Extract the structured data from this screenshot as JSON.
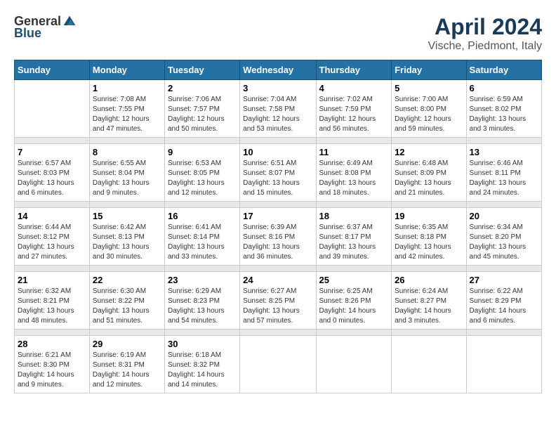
{
  "logo": {
    "general": "General",
    "blue": "Blue"
  },
  "title": "April 2024",
  "subtitle": "Vische, Piedmont, Italy",
  "days_header": [
    "Sunday",
    "Monday",
    "Tuesday",
    "Wednesday",
    "Thursday",
    "Friday",
    "Saturday"
  ],
  "weeks": [
    {
      "days": [
        {
          "number": "",
          "sunrise": "",
          "sunset": "",
          "daylight": ""
        },
        {
          "number": "1",
          "sunrise": "Sunrise: 7:08 AM",
          "sunset": "Sunset: 7:55 PM",
          "daylight": "Daylight: 12 hours and 47 minutes."
        },
        {
          "number": "2",
          "sunrise": "Sunrise: 7:06 AM",
          "sunset": "Sunset: 7:57 PM",
          "daylight": "Daylight: 12 hours and 50 minutes."
        },
        {
          "number": "3",
          "sunrise": "Sunrise: 7:04 AM",
          "sunset": "Sunset: 7:58 PM",
          "daylight": "Daylight: 12 hours and 53 minutes."
        },
        {
          "number": "4",
          "sunrise": "Sunrise: 7:02 AM",
          "sunset": "Sunset: 7:59 PM",
          "daylight": "Daylight: 12 hours and 56 minutes."
        },
        {
          "number": "5",
          "sunrise": "Sunrise: 7:00 AM",
          "sunset": "Sunset: 8:00 PM",
          "daylight": "Daylight: 12 hours and 59 minutes."
        },
        {
          "number": "6",
          "sunrise": "Sunrise: 6:59 AM",
          "sunset": "Sunset: 8:02 PM",
          "daylight": "Daylight: 13 hours and 3 minutes."
        }
      ]
    },
    {
      "days": [
        {
          "number": "7",
          "sunrise": "Sunrise: 6:57 AM",
          "sunset": "Sunset: 8:03 PM",
          "daylight": "Daylight: 13 hours and 6 minutes."
        },
        {
          "number": "8",
          "sunrise": "Sunrise: 6:55 AM",
          "sunset": "Sunset: 8:04 PM",
          "daylight": "Daylight: 13 hours and 9 minutes."
        },
        {
          "number": "9",
          "sunrise": "Sunrise: 6:53 AM",
          "sunset": "Sunset: 8:05 PM",
          "daylight": "Daylight: 13 hours and 12 minutes."
        },
        {
          "number": "10",
          "sunrise": "Sunrise: 6:51 AM",
          "sunset": "Sunset: 8:07 PM",
          "daylight": "Daylight: 13 hours and 15 minutes."
        },
        {
          "number": "11",
          "sunrise": "Sunrise: 6:49 AM",
          "sunset": "Sunset: 8:08 PM",
          "daylight": "Daylight: 13 hours and 18 minutes."
        },
        {
          "number": "12",
          "sunrise": "Sunrise: 6:48 AM",
          "sunset": "Sunset: 8:09 PM",
          "daylight": "Daylight: 13 hours and 21 minutes."
        },
        {
          "number": "13",
          "sunrise": "Sunrise: 6:46 AM",
          "sunset": "Sunset: 8:11 PM",
          "daylight": "Daylight: 13 hours and 24 minutes."
        }
      ]
    },
    {
      "days": [
        {
          "number": "14",
          "sunrise": "Sunrise: 6:44 AM",
          "sunset": "Sunset: 8:12 PM",
          "daylight": "Daylight: 13 hours and 27 minutes."
        },
        {
          "number": "15",
          "sunrise": "Sunrise: 6:42 AM",
          "sunset": "Sunset: 8:13 PM",
          "daylight": "Daylight: 13 hours and 30 minutes."
        },
        {
          "number": "16",
          "sunrise": "Sunrise: 6:41 AM",
          "sunset": "Sunset: 8:14 PM",
          "daylight": "Daylight: 13 hours and 33 minutes."
        },
        {
          "number": "17",
          "sunrise": "Sunrise: 6:39 AM",
          "sunset": "Sunset: 8:16 PM",
          "daylight": "Daylight: 13 hours and 36 minutes."
        },
        {
          "number": "18",
          "sunrise": "Sunrise: 6:37 AM",
          "sunset": "Sunset: 8:17 PM",
          "daylight": "Daylight: 13 hours and 39 minutes."
        },
        {
          "number": "19",
          "sunrise": "Sunrise: 6:35 AM",
          "sunset": "Sunset: 8:18 PM",
          "daylight": "Daylight: 13 hours and 42 minutes."
        },
        {
          "number": "20",
          "sunrise": "Sunrise: 6:34 AM",
          "sunset": "Sunset: 8:20 PM",
          "daylight": "Daylight: 13 hours and 45 minutes."
        }
      ]
    },
    {
      "days": [
        {
          "number": "21",
          "sunrise": "Sunrise: 6:32 AM",
          "sunset": "Sunset: 8:21 PM",
          "daylight": "Daylight: 13 hours and 48 minutes."
        },
        {
          "number": "22",
          "sunrise": "Sunrise: 6:30 AM",
          "sunset": "Sunset: 8:22 PM",
          "daylight": "Daylight: 13 hours and 51 minutes."
        },
        {
          "number": "23",
          "sunrise": "Sunrise: 6:29 AM",
          "sunset": "Sunset: 8:23 PM",
          "daylight": "Daylight: 13 hours and 54 minutes."
        },
        {
          "number": "24",
          "sunrise": "Sunrise: 6:27 AM",
          "sunset": "Sunset: 8:25 PM",
          "daylight": "Daylight: 13 hours and 57 minutes."
        },
        {
          "number": "25",
          "sunrise": "Sunrise: 6:25 AM",
          "sunset": "Sunset: 8:26 PM",
          "daylight": "Daylight: 14 hours and 0 minutes."
        },
        {
          "number": "26",
          "sunrise": "Sunrise: 6:24 AM",
          "sunset": "Sunset: 8:27 PM",
          "daylight": "Daylight: 14 hours and 3 minutes."
        },
        {
          "number": "27",
          "sunrise": "Sunrise: 6:22 AM",
          "sunset": "Sunset: 8:29 PM",
          "daylight": "Daylight: 14 hours and 6 minutes."
        }
      ]
    },
    {
      "days": [
        {
          "number": "28",
          "sunrise": "Sunrise: 6:21 AM",
          "sunset": "Sunset: 8:30 PM",
          "daylight": "Daylight: 14 hours and 9 minutes."
        },
        {
          "number": "29",
          "sunrise": "Sunrise: 6:19 AM",
          "sunset": "Sunset: 8:31 PM",
          "daylight": "Daylight: 14 hours and 12 minutes."
        },
        {
          "number": "30",
          "sunrise": "Sunrise: 6:18 AM",
          "sunset": "Sunset: 8:32 PM",
          "daylight": "Daylight: 14 hours and 14 minutes."
        },
        {
          "number": "",
          "sunrise": "",
          "sunset": "",
          "daylight": ""
        },
        {
          "number": "",
          "sunrise": "",
          "sunset": "",
          "daylight": ""
        },
        {
          "number": "",
          "sunrise": "",
          "sunset": "",
          "daylight": ""
        },
        {
          "number": "",
          "sunrise": "",
          "sunset": "",
          "daylight": ""
        }
      ]
    }
  ]
}
